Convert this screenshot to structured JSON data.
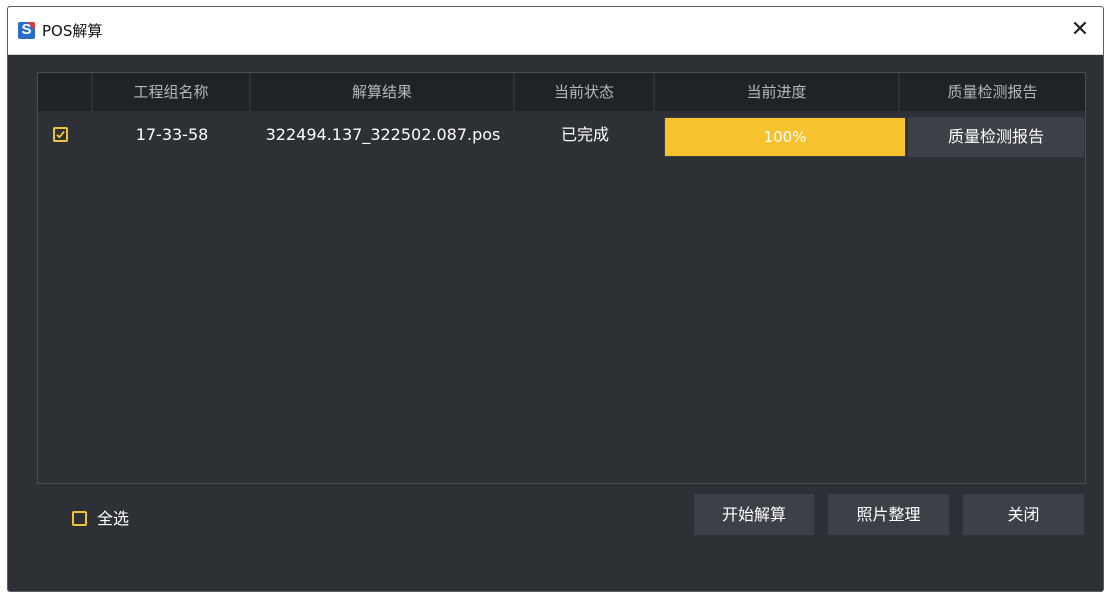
{
  "window": {
    "title": "POS解算",
    "close_glyph": "✕"
  },
  "table": {
    "columns": [
      "",
      "工程组名称",
      "解算结果",
      "当前状态",
      "当前进度",
      "质量检测报告"
    ],
    "rows": [
      {
        "checked": true,
        "group_name": "17-33-58",
        "result": "322494.137_322502.087.pos",
        "status": "已完成",
        "progress_value": 1.0,
        "progress_text": "100%",
        "report_label": "质量检测报告"
      }
    ]
  },
  "footer": {
    "select_all_label": "全选",
    "select_all_checked": false,
    "start_button": "开始解算",
    "photo_button": "照片整理",
    "close_button": "关闭"
  },
  "colors": {
    "accent": "#f1c33a",
    "progress_fill": "#f6c22d",
    "background": "#2d3035",
    "header_bg": "#1f2226"
  }
}
